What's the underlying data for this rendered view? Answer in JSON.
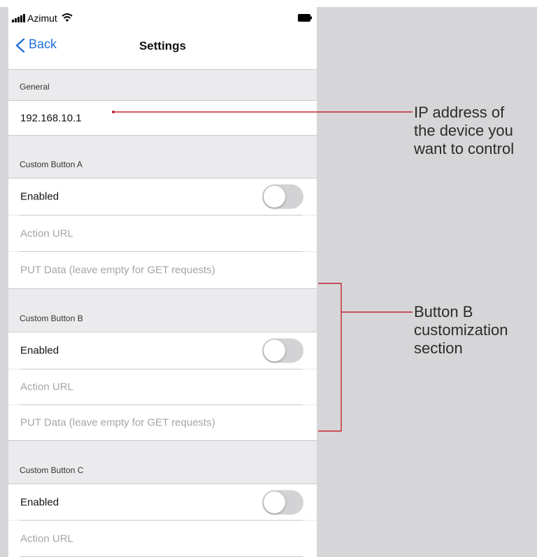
{
  "status_bar": {
    "carrier": "Azimut"
  },
  "nav": {
    "back_label": "Back",
    "title": "Settings"
  },
  "general": {
    "header": "General",
    "ip_value": "192.168.10.1"
  },
  "button_a": {
    "header": "Custom Button A",
    "enabled_label": "Enabled",
    "enabled": false,
    "action_url_placeholder": "Action URL",
    "put_data_placeholder": "PUT Data (leave empty for GET requests)"
  },
  "button_b": {
    "header": "Custom Button B",
    "enabled_label": "Enabled",
    "enabled": false,
    "action_url_placeholder": "Action URL",
    "put_data_placeholder": "PUT Data (leave empty for GET requests)"
  },
  "button_c": {
    "header": "Custom Button C",
    "enabled_label": "Enabled",
    "enabled": false,
    "action_url_placeholder": "Action URL"
  },
  "annotations": {
    "ip_note": [
      "IP address of",
      "the device you",
      "want to control"
    ],
    "button_b_note": [
      "Button B",
      "customization",
      "section"
    ]
  },
  "colors": {
    "accent": "#1f6fdb",
    "annotation_line": "#c2272d",
    "toggle_off": "#d3d3d6",
    "placeholder": "#a5a5a8"
  }
}
